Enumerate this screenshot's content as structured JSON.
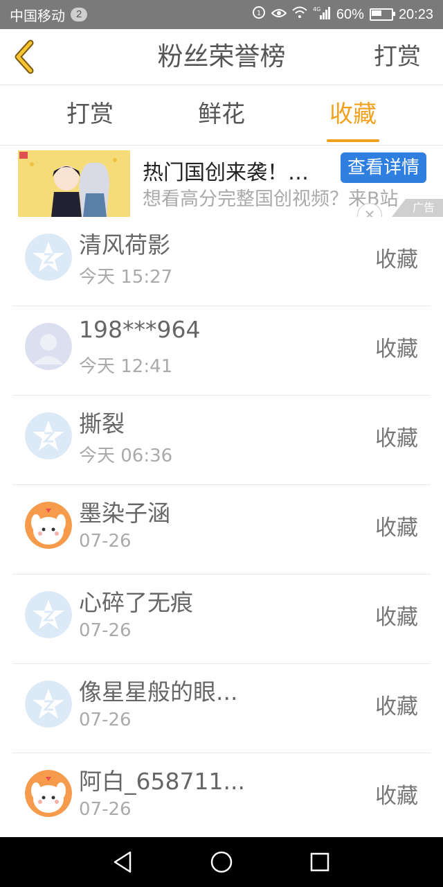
{
  "status_bar": {
    "carrier": "中国移动",
    "notification_count": "2",
    "network": "4G",
    "battery": "60%",
    "battery_level": 0.6,
    "time": "20:23"
  },
  "header": {
    "title": "粉丝荣誉榜",
    "action": "打赏",
    "back_icon": "chevron-left-icon",
    "accent_color": "#f2a11f"
  },
  "tabs": [
    {
      "label": "打赏",
      "active": false
    },
    {
      "label": "鲜花",
      "active": false
    },
    {
      "label": "收藏",
      "active": true
    }
  ],
  "ad": {
    "title": "热门国创来袭！…",
    "button": "查看详情",
    "subtitle": "想看高分完整国创视频？来B站",
    "badge": "广告",
    "close_icon": "close-icon",
    "button_color": "#2e7fe0"
  },
  "list": [
    {
      "name": "清风荷影",
      "time": "今天 15:27",
      "action": "收藏",
      "avatar": "qq-star-icon"
    },
    {
      "name": "198***964",
      "time": "今天 12:41",
      "action": "收藏",
      "avatar": "default-person-icon"
    },
    {
      "name": "撕裂",
      "time": "今天 06:36",
      "action": "收藏",
      "avatar": "qq-star-icon"
    },
    {
      "name": "墨染子涵",
      "time": "07-26",
      "action": "收藏",
      "avatar": "cute-character-avatar"
    },
    {
      "name": "心碎了无痕",
      "time": "07-26",
      "action": "收藏",
      "avatar": "qq-star-icon"
    },
    {
      "name": "像星星般的眼...",
      "time": "07-26",
      "action": "收藏",
      "avatar": "qq-star-icon"
    },
    {
      "name": "阿白_658711...",
      "time": "07-26",
      "action": "收藏",
      "avatar": "cute-character-avatar"
    }
  ],
  "nav_bar": {
    "back": "triangle-back-icon",
    "home": "circle-home-icon",
    "recents": "square-recents-icon"
  }
}
